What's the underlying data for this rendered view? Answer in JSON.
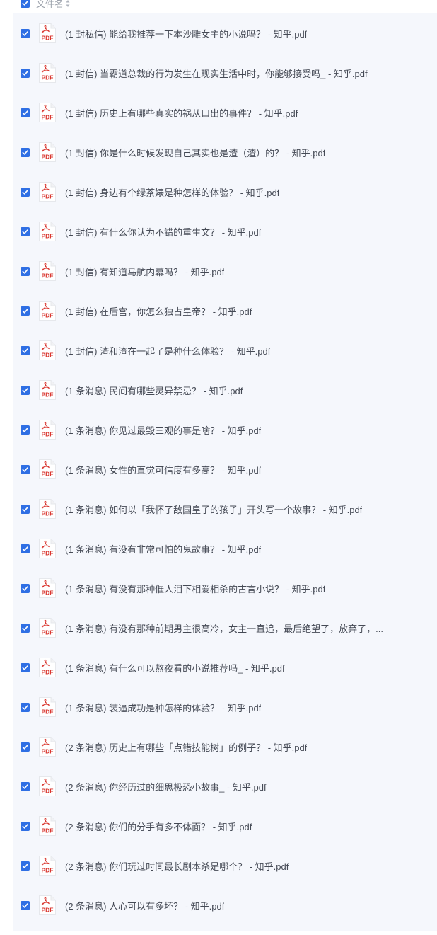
{
  "header": {
    "column_label": "文件名"
  },
  "icons": {
    "file_type": "pdf-icon",
    "checkbox_state": "checked",
    "sort": "sort-icon"
  },
  "colors": {
    "accent": "#2f6fe4",
    "pdf_red": "#d9362f",
    "list_background": "#f5f7fc"
  },
  "pdf_icon_label": "PDF",
  "files": [
    {
      "name": "(1 封私信) 能给我推荐一下本沙雕女主的小说吗？ - 知乎.pdf",
      "checked": true
    },
    {
      "name": "(1 封信) 当霸道总裁的行为发生在现实生活中时，你能够接受吗_ - 知乎.pdf",
      "checked": true
    },
    {
      "name": "(1 封信) 历史上有哪些真实的祸从口出的事件？ - 知乎.pdf",
      "checked": true
    },
    {
      "name": "(1 封信) 你是什么时候发现自己其实也是渣（渣）的？ - 知乎.pdf",
      "checked": true
    },
    {
      "name": "(1 封信) 身边有个绿茶婊是种怎样的体验？ - 知乎.pdf",
      "checked": true
    },
    {
      "name": "(1 封信) 有什么你认为不错的重生文？ - 知乎.pdf",
      "checked": true
    },
    {
      "name": "(1 封信) 有知道马航内幕吗？ - 知乎.pdf",
      "checked": true
    },
    {
      "name": "(1 封信) 在后宫，你怎么独占皇帝？ - 知乎.pdf",
      "checked": true
    },
    {
      "name": "(1 封信) 渣和渣在一起了是种什么体验？ - 知乎.pdf",
      "checked": true
    },
    {
      "name": "(1 条消息) 民间有哪些灵异禁忌？ - 知乎.pdf",
      "checked": true
    },
    {
      "name": "(1 条消息) 你见过最毁三观的事是啥？ - 知乎.pdf",
      "checked": true
    },
    {
      "name": "(1 条消息) 女性的直觉可信度有多高？ - 知乎.pdf",
      "checked": true
    },
    {
      "name": "(1 条消息) 如何以「我怀了敌国皇子的孩子」开头写一个故事？ - 知乎.pdf",
      "checked": true
    },
    {
      "name": "(1 条消息) 有没有非常可怕的鬼故事？ - 知乎.pdf",
      "checked": true
    },
    {
      "name": "(1 条消息) 有没有那种催人泪下相爱相杀的古言小说？ - 知乎.pdf",
      "checked": true
    },
    {
      "name": "(1 条消息) 有没有那种前期男主很高冷，女主一直追，最后绝望了，放弃了，...",
      "checked": true
    },
    {
      "name": "(1 条消息) 有什么可以熬夜看的小说推荐吗_ - 知乎.pdf",
      "checked": true
    },
    {
      "name": "(1 条消息) 装逼成功是种怎样的体验？ - 知乎.pdf",
      "checked": true
    },
    {
      "name": "(2 条消息) 历史上有哪些「点错技能树」的例子？ - 知乎.pdf",
      "checked": true
    },
    {
      "name": "(2 条消息) 你经历过的细思极恐小故事_ - 知乎.pdf",
      "checked": true
    },
    {
      "name": "(2 条消息) 你们的分手有多不体面？ - 知乎.pdf",
      "checked": true
    },
    {
      "name": "(2 条消息) 你们玩过时间最长剧本杀是哪个？ - 知乎.pdf",
      "checked": true
    },
    {
      "name": "(2 条消息) 人心可以有多坏？ - 知乎.pdf",
      "checked": true
    }
  ]
}
